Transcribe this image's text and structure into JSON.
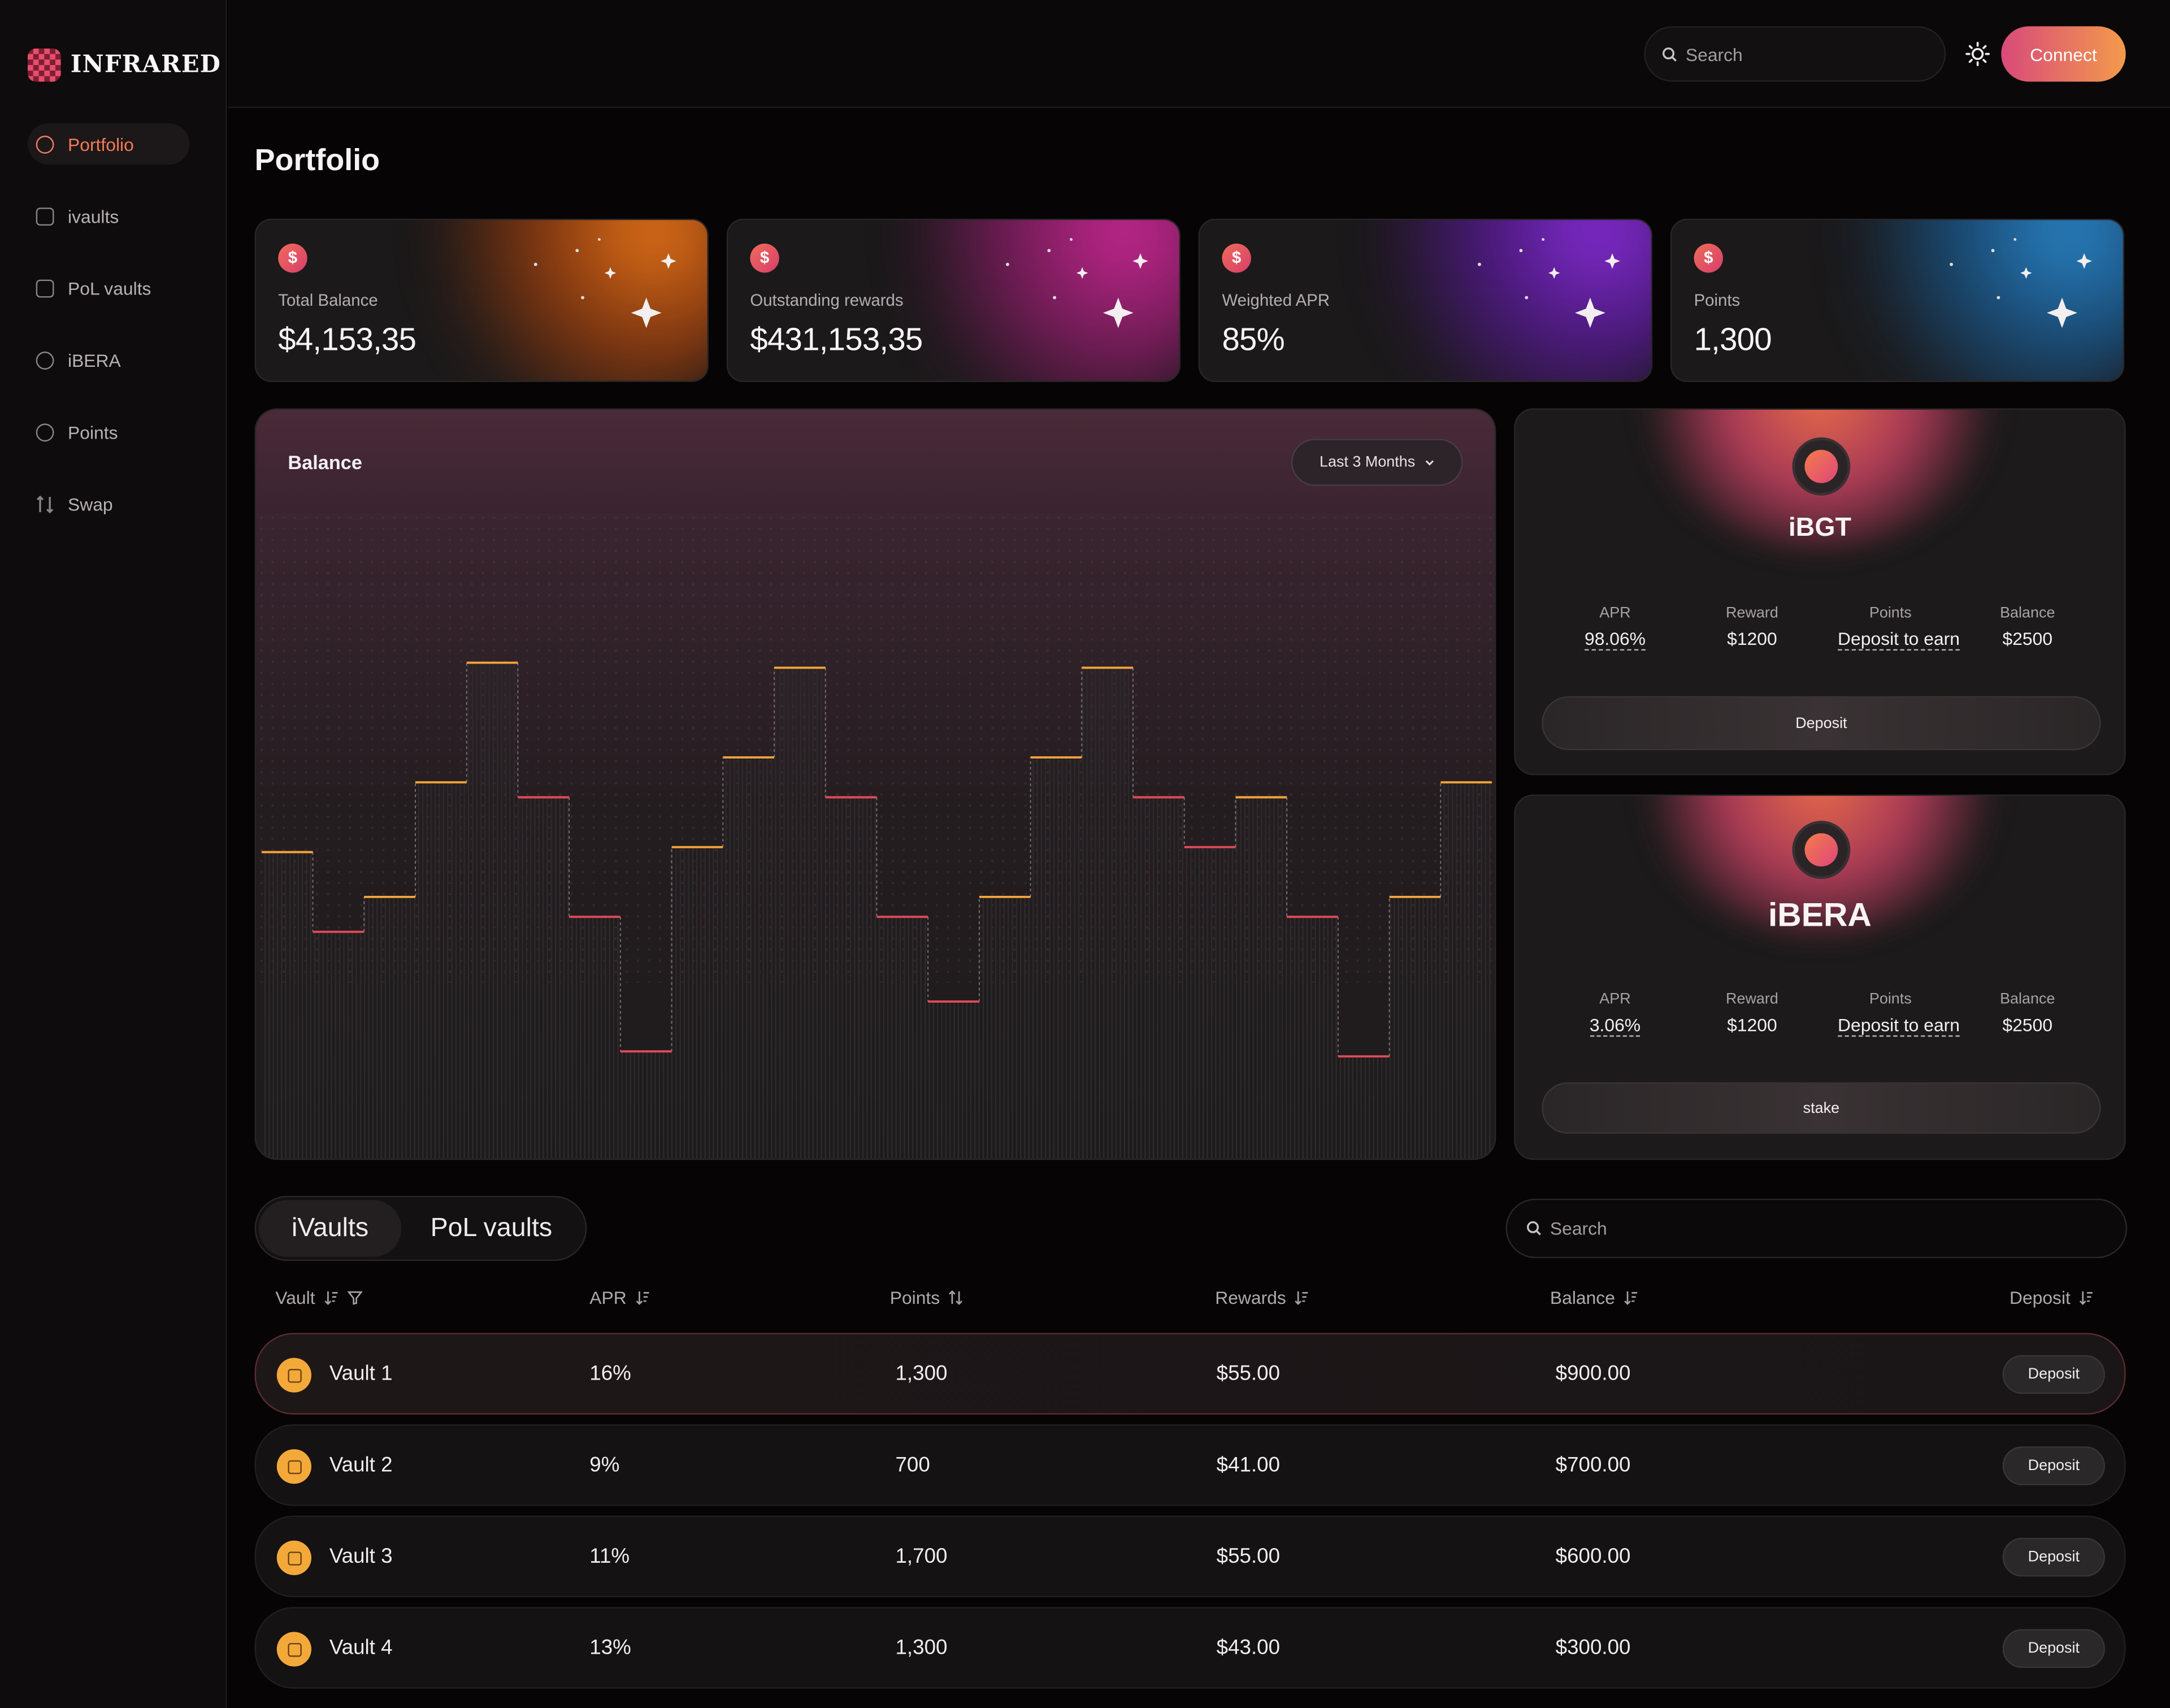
{
  "brand": {
    "name": "INFRARED"
  },
  "sidebar": {
    "items": [
      {
        "label": "Portfolio",
        "icon": "portfolio-icon",
        "active": true
      },
      {
        "label": "ivaults",
        "icon": "vault-icon"
      },
      {
        "label": "PoL vaults",
        "icon": "pol-vault-icon"
      },
      {
        "label": "iBERA",
        "icon": "bear-icon"
      },
      {
        "label": "Points",
        "icon": "points-icon"
      },
      {
        "label": "Swap",
        "icon": "swap-icon"
      }
    ]
  },
  "header": {
    "search_placeholder": "Search",
    "theme_icon": "sun-icon",
    "connect_label": "Connect"
  },
  "page": {
    "title": "Portfolio"
  },
  "stats": [
    {
      "label": "Total Balance",
      "value": "$4,153,35",
      "color": "#e8731f"
    },
    {
      "label": "Outstanding rewards",
      "value": "$431,153,35",
      "color": "#c8278a"
    },
    {
      "label": "Weighted APR",
      "value": "85%",
      "color": "#8a2bd8"
    },
    {
      "label": "Points",
      "value": "1,300",
      "color": "#2b83c7"
    }
  ],
  "balance_chart": {
    "title": "Balance",
    "range_label": "Last 3 Months"
  },
  "chart_data": {
    "type": "line",
    "title": "Balance",
    "values": [
      54,
      38,
      45,
      68,
      92,
      65,
      41,
      14,
      55,
      73,
      91,
      65,
      41,
      24,
      45,
      73,
      91,
      65,
      55,
      65,
      41,
      13,
      45,
      68
    ],
    "ylim": [
      0,
      100
    ],
    "xlabel": "",
    "ylabel": "",
    "grid": false,
    "colors": {
      "rise": "#f2a33a",
      "fall": "#e04a5a"
    }
  },
  "tokens": [
    {
      "name": "iBGT",
      "icon": "ibgt-token-icon",
      "stats": [
        {
          "label": "APR",
          "value": "98.06%",
          "underline": true
        },
        {
          "label": "Reward",
          "value": "$1200",
          "underline": false
        },
        {
          "label": "Points",
          "value": "Deposit to earn",
          "underline": true
        },
        {
          "label": "Balance",
          "value": "$2500",
          "underline": false
        }
      ],
      "action": "Deposit"
    },
    {
      "name": "iBERA",
      "icon": "ibera-token-icon",
      "stats": [
        {
          "label": "APR",
          "value": "3.06%",
          "underline": true
        },
        {
          "label": "Reward",
          "value": "$1200",
          "underline": false
        },
        {
          "label": "Points",
          "value": "Deposit to earn",
          "underline": true
        },
        {
          "label": "Balance",
          "value": "$2500",
          "underline": false
        }
      ],
      "action": "stake"
    }
  ],
  "vault_tabs": [
    {
      "label": "iVaults",
      "active": true
    },
    {
      "label": "PoL vaults",
      "active": false
    }
  ],
  "table": {
    "search_placeholder": "Search",
    "columns": [
      "Vault",
      "APR",
      "Points",
      "Rewards",
      "Balance",
      "Deposit"
    ],
    "rows": [
      {
        "vault": "Vault 1",
        "apr": "16%",
        "points": "1,300",
        "rewards": "$55.00",
        "balance": "$900.00",
        "action": "Deposit"
      },
      {
        "vault": "Vault 2",
        "apr": "9%",
        "points": "700",
        "rewards": "$41.00",
        "balance": "$700.00",
        "action": "Deposit"
      },
      {
        "vault": "Vault 3",
        "apr": "11%",
        "points": "1,700",
        "rewards": "$55.00",
        "balance": "$600.00",
        "action": "Deposit"
      },
      {
        "vault": "Vault 4",
        "apr": "13%",
        "points": "1,300",
        "rewards": "$43.00",
        "balance": "$300.00",
        "action": "Deposit"
      }
    ]
  }
}
